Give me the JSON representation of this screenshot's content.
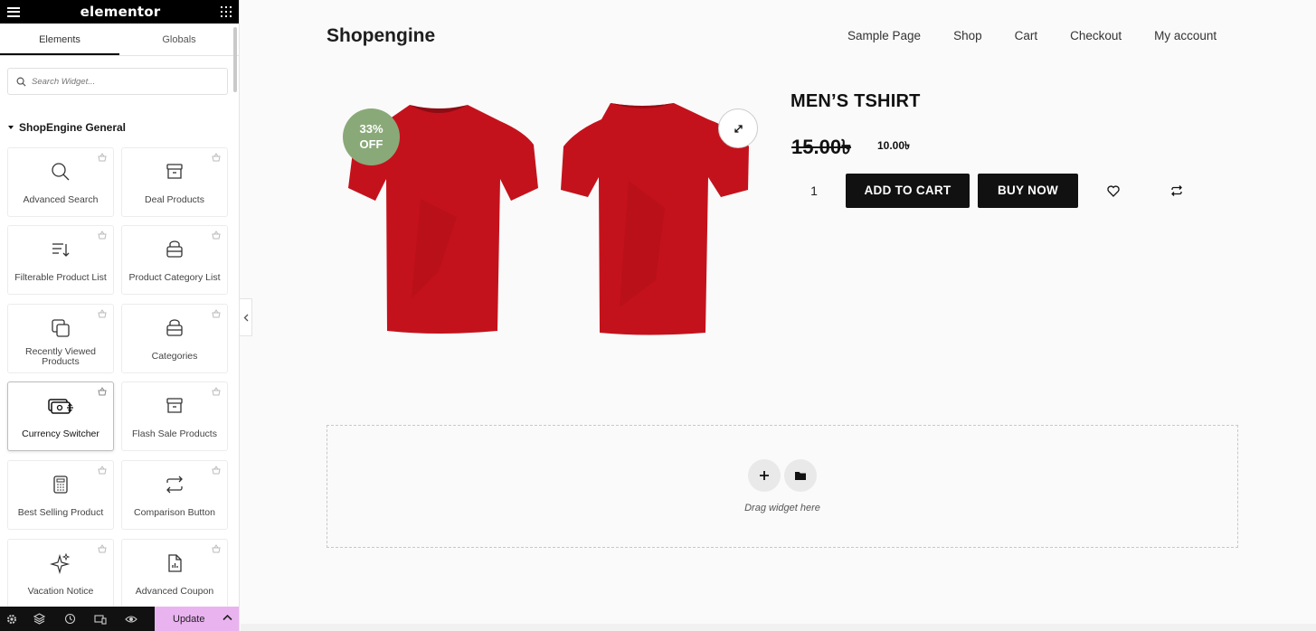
{
  "editor": {
    "logo": "elementor",
    "tabs": [
      {
        "label": "Elements"
      },
      {
        "label": "Globals"
      }
    ],
    "search_placeholder": "Search Widget...",
    "section_title": "ShopEngine General",
    "widgets": [
      {
        "label": "Advanced Search",
        "icon": "search-icon"
      },
      {
        "label": "Deal Products",
        "icon": "archive-box-icon"
      },
      {
        "label": "Filterable Product List",
        "icon": "filter-list-icon"
      },
      {
        "label": "Product Category List",
        "icon": "stack-icon"
      },
      {
        "label": "Recently Viewed Products",
        "icon": "copy-icon"
      },
      {
        "label": "Categories",
        "icon": "stack-icon"
      },
      {
        "label": "Currency Switcher",
        "icon": "currency-icon"
      },
      {
        "label": "Flash Sale Products",
        "icon": "archive-box-icon"
      },
      {
        "label": "Best Selling Product",
        "icon": "calculator-icon"
      },
      {
        "label": "Comparison Button",
        "icon": "arrows-exchange-icon"
      },
      {
        "label": "Vacation Notice",
        "icon": "sparkle-icon"
      },
      {
        "label": "Advanced Coupon",
        "icon": "document-chart-icon"
      }
    ],
    "update_label": "Update"
  },
  "site": {
    "brand": "Shopengine",
    "nav": [
      "Sample Page",
      "Shop",
      "Cart",
      "Checkout",
      "My account"
    ]
  },
  "product": {
    "badge_percent": "33%",
    "badge_text": "OFF",
    "title": "MEN’S TSHIRT",
    "old_price": "15.00৳",
    "new_price": "10.00৳",
    "quantity": "1",
    "add_to_cart": "ADD TO CART",
    "buy_now": "BUY NOW",
    "shirt_color": "#c4121c"
  },
  "dropzone": {
    "label": "Drag widget here"
  }
}
